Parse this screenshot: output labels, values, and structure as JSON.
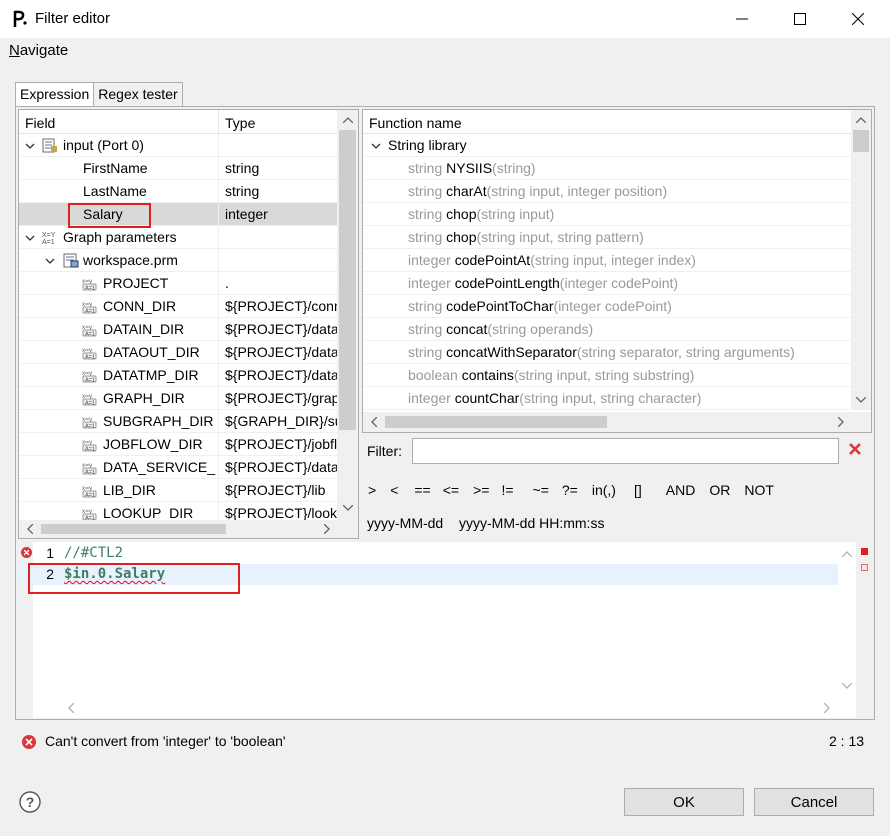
{
  "window": {
    "title": "Filter editor"
  },
  "menu": {
    "navigate": "Navigate",
    "navigate_mnemonic": "N",
    "navigate_rest": "avigate"
  },
  "tabs": [
    {
      "label": "Expression",
      "active": true
    },
    {
      "label": "Regex tester",
      "active": false
    }
  ],
  "tree": {
    "headers": {
      "field": "Field",
      "type": "Type"
    },
    "rows": [
      {
        "name": "input (Port 0)",
        "type": "",
        "level": 0,
        "expanded": true,
        "icon": "record-icon"
      },
      {
        "name": "FirstName",
        "type": "string",
        "level": 1,
        "icon": ""
      },
      {
        "name": "LastName",
        "type": "string",
        "level": 1,
        "icon": ""
      },
      {
        "name": "Salary",
        "type": "integer",
        "level": 1,
        "icon": "",
        "selected": true
      },
      {
        "name": "Graph parameters",
        "type": "",
        "level": 0,
        "expanded": true,
        "icon": "graph-params-icon"
      },
      {
        "name": "workspace.prm",
        "type": "",
        "level": 1,
        "expanded": true,
        "icon": "prm-file-icon"
      },
      {
        "name": "PROJECT",
        "type": ".",
        "level": 2,
        "icon": "parameter-icon"
      },
      {
        "name": "CONN_DIR",
        "type": "${PROJECT}/conn",
        "level": 2,
        "icon": "parameter-icon"
      },
      {
        "name": "DATAIN_DIR",
        "type": "${PROJECT}/data",
        "level": 2,
        "icon": "parameter-icon"
      },
      {
        "name": "DATAOUT_DIR",
        "type": "${PROJECT}/data",
        "level": 2,
        "icon": "parameter-icon"
      },
      {
        "name": "DATATMP_DIR",
        "type": "${PROJECT}/data",
        "level": 2,
        "icon": "parameter-icon"
      },
      {
        "name": "GRAPH_DIR",
        "type": "${PROJECT}/grap",
        "level": 2,
        "icon": "parameter-icon"
      },
      {
        "name": "SUBGRAPH_DIR",
        "type": "${GRAPH_DIR}/su",
        "level": 2,
        "icon": "parameter-icon"
      },
      {
        "name": "JOBFLOW_DIR",
        "type": "${PROJECT}/jobfl",
        "level": 2,
        "icon": "parameter-icon"
      },
      {
        "name": "DATA_SERVICE_D",
        "type": "${PROJECT}/data",
        "level": 2,
        "icon": "parameter-icon"
      },
      {
        "name": "LIB_DIR",
        "type": "${PROJECT}/lib",
        "level": 2,
        "icon": "parameter-icon"
      },
      {
        "name": "LOOKUP_DIR",
        "type": "${PROJECT}/looku",
        "level": 2,
        "icon": "parameter-icon"
      }
    ]
  },
  "functions": {
    "header": "Function name",
    "group": "String library",
    "items": [
      {
        "ret": "string",
        "name": "NYSIIS",
        "args": "(string)"
      },
      {
        "ret": "string",
        "name": "charAt",
        "args": "(string input, integer position)"
      },
      {
        "ret": "string",
        "name": "chop",
        "args": "(string input)"
      },
      {
        "ret": "string",
        "name": "chop",
        "args": "(string input, string pattern)"
      },
      {
        "ret": "integer",
        "name": "codePointAt",
        "args": "(string input, integer index)"
      },
      {
        "ret": "integer",
        "name": "codePointLength",
        "args": "(integer codePoint)"
      },
      {
        "ret": "string",
        "name": "codePointToChar",
        "args": "(integer codePoint)"
      },
      {
        "ret": "string",
        "name": "concat",
        "args": "(string operands)"
      },
      {
        "ret": "string",
        "name": "concatWithSeparator",
        "args": "(string separator, string arguments)"
      },
      {
        "ret": "boolean",
        "name": "contains",
        "args": "(string input, string substring)"
      },
      {
        "ret": "integer",
        "name": "countChar",
        "args": "(string input, string character)"
      }
    ]
  },
  "filter": {
    "label": "Filter:",
    "value": ""
  },
  "operators": [
    ">",
    "<",
    "==",
    "<=",
    ">=",
    "!=",
    "~=",
    "?=",
    "in(,)",
    "[]",
    "AND",
    "OR",
    "NOT"
  ],
  "date_formats": [
    "yyyy-MM-dd",
    "yyyy-MM-dd HH:mm:ss"
  ],
  "editor": {
    "lines": [
      {
        "num": "1",
        "text": "//#CTL2"
      },
      {
        "num": "2",
        "text": "$in.0.Salary"
      }
    ]
  },
  "status": {
    "error": "Can't convert from 'integer' to 'boolean'",
    "position": "2 : 13"
  },
  "buttons": {
    "ok": "OK",
    "cancel": "Cancel"
  },
  "colors": {
    "error": "#d9363e",
    "highlight": "#e02020",
    "comment": "#3f7f5f"
  }
}
